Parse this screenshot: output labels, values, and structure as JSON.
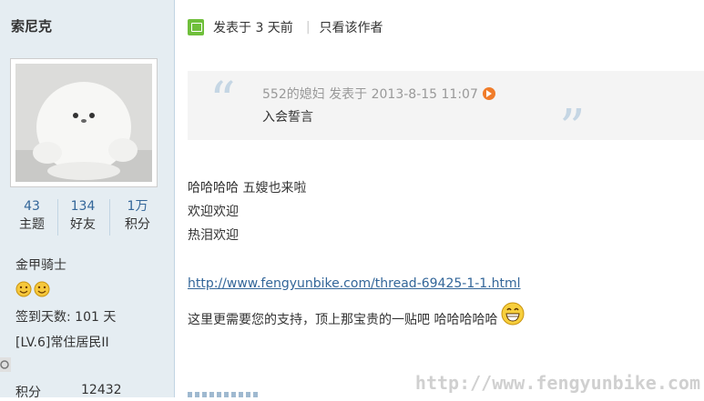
{
  "sidebar": {
    "username": "索尼克",
    "stats": [
      {
        "value": "43",
        "label": "主题"
      },
      {
        "value": "134",
        "label": "好友"
      },
      {
        "value": "1万",
        "label": "积分"
      }
    ],
    "rank_title": "金甲骑士",
    "checkin_days": "签到天数: 101 天",
    "level": "[LV.6]常住居民II",
    "points_label": "积分",
    "points_value": "12432"
  },
  "post": {
    "posted_at": "发表于  3 天前",
    "only_author": "只看该作者",
    "quote": {
      "meta": "552的媳妇  发表于  2013-8-15 11:07",
      "text": "入会誓言"
    },
    "lines": [
      "哈哈哈哈  五嫂也来啦",
      "欢迎欢迎",
      "热泪欢迎"
    ],
    "link": "http://www.fengyunbike.com/thread-69425-1-1.html",
    "support_text": "这里更需要您的支持，顶上那宝贵的一贴吧  哈哈哈哈哈"
  },
  "watermark": "http://www.fengyunbike.com",
  "colors": {
    "sidebar_bg": "#e5edf2",
    "link": "#336699",
    "quote_bg": "#f4f4f4"
  }
}
